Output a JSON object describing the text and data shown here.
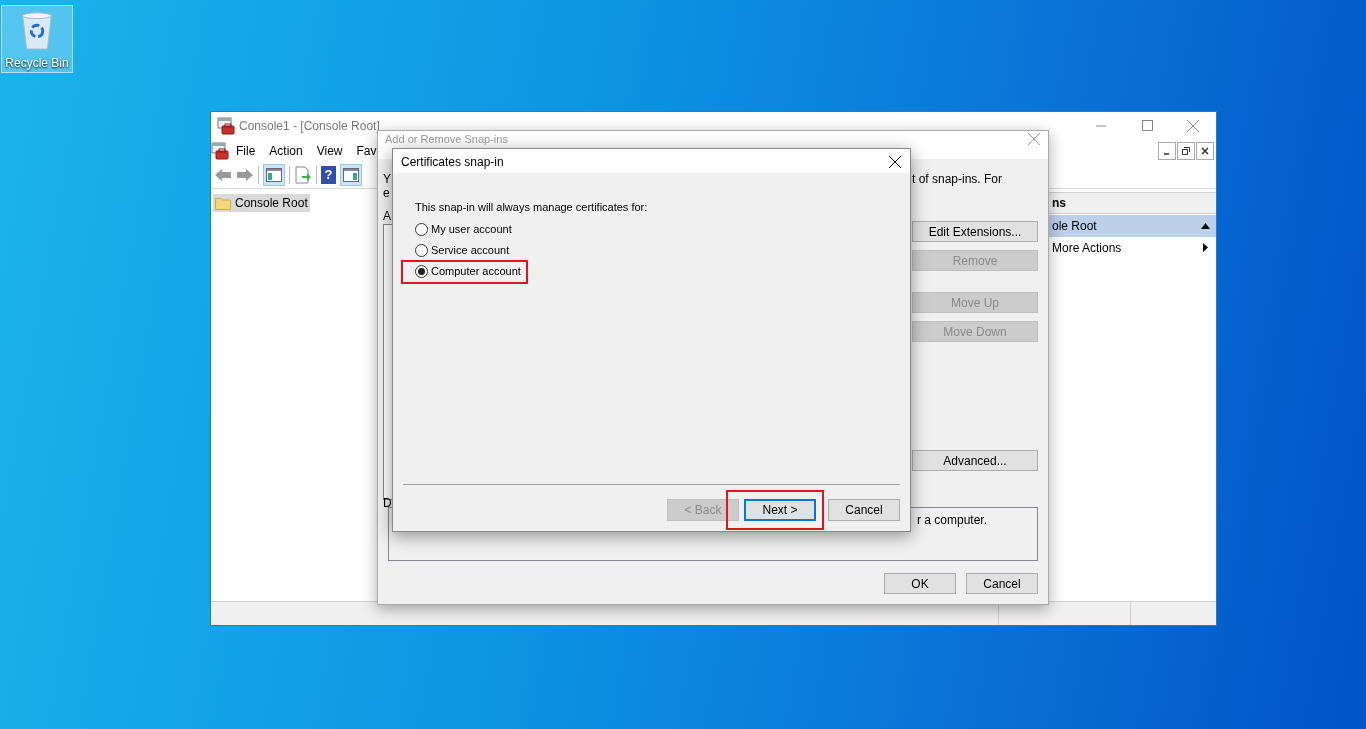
{
  "desktop": {
    "icons": [
      {
        "label": "Recycle Bin",
        "selected": true
      }
    ]
  },
  "console": {
    "title": "Console1 - [Console Root]",
    "menu": [
      "File",
      "Action",
      "View",
      "Fav"
    ],
    "toolbar_help_glyph": "?",
    "tree": [
      {
        "label": "Console Root",
        "selected": true
      }
    ],
    "actions": {
      "header": "ns",
      "items": [
        {
          "label": "ole Root",
          "kind": "group"
        },
        {
          "label": "More Actions",
          "kind": "submenu"
        }
      ]
    }
  },
  "snapins_dialog": {
    "title": "Add or Remove Snap-ins",
    "fragments": [
      "Y",
      "e",
      "A"
    ],
    "intro_tail": "t of snap-ins. For",
    "buttons": [
      {
        "label": "Edit Extensions...",
        "disabled": false
      },
      {
        "label": "Remove",
        "disabled": true
      },
      {
        "label": "Move Up",
        "disabled": true
      },
      {
        "label": "Move Down",
        "disabled": true
      },
      {
        "label": "Advanced...",
        "disabled": false
      }
    ],
    "description_label": "D",
    "description_tail": "r a computer.",
    "footer_buttons": [
      {
        "label": "OK",
        "disabled": false
      },
      {
        "label": "Cancel",
        "disabled": false
      }
    ]
  },
  "certificates_dialog": {
    "title": "Certificates snap-in",
    "prompt": "This snap-in will always manage certificates for:",
    "options": [
      {
        "label": "My user account",
        "selected": false,
        "highlighted": false
      },
      {
        "label": "Service account",
        "selected": false,
        "highlighted": false
      },
      {
        "label": "Computer account",
        "selected": true,
        "highlighted": true
      }
    ],
    "buttons": [
      {
        "label": "< Back",
        "disabled": true,
        "default": false,
        "highlighted": false
      },
      {
        "label": "Next >",
        "disabled": false,
        "default": true,
        "highlighted": true
      },
      {
        "label": "Cancel",
        "disabled": false,
        "default": false,
        "highlighted": false
      }
    ]
  }
}
